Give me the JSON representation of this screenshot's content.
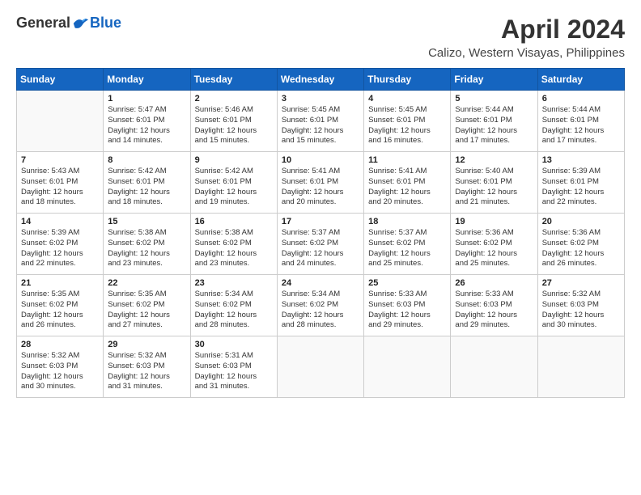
{
  "header": {
    "logo_general": "General",
    "logo_blue": "Blue",
    "month_title": "April 2024",
    "location": "Calizo, Western Visayas, Philippines"
  },
  "weekdays": [
    "Sunday",
    "Monday",
    "Tuesday",
    "Wednesday",
    "Thursday",
    "Friday",
    "Saturday"
  ],
  "weeks": [
    [
      {
        "day": "",
        "info": ""
      },
      {
        "day": "1",
        "info": "Sunrise: 5:47 AM\nSunset: 6:01 PM\nDaylight: 12 hours\nand 14 minutes."
      },
      {
        "day": "2",
        "info": "Sunrise: 5:46 AM\nSunset: 6:01 PM\nDaylight: 12 hours\nand 15 minutes."
      },
      {
        "day": "3",
        "info": "Sunrise: 5:45 AM\nSunset: 6:01 PM\nDaylight: 12 hours\nand 15 minutes."
      },
      {
        "day": "4",
        "info": "Sunrise: 5:45 AM\nSunset: 6:01 PM\nDaylight: 12 hours\nand 16 minutes."
      },
      {
        "day": "5",
        "info": "Sunrise: 5:44 AM\nSunset: 6:01 PM\nDaylight: 12 hours\nand 17 minutes."
      },
      {
        "day": "6",
        "info": "Sunrise: 5:44 AM\nSunset: 6:01 PM\nDaylight: 12 hours\nand 17 minutes."
      }
    ],
    [
      {
        "day": "7",
        "info": "Sunrise: 5:43 AM\nSunset: 6:01 PM\nDaylight: 12 hours\nand 18 minutes."
      },
      {
        "day": "8",
        "info": "Sunrise: 5:42 AM\nSunset: 6:01 PM\nDaylight: 12 hours\nand 18 minutes."
      },
      {
        "day": "9",
        "info": "Sunrise: 5:42 AM\nSunset: 6:01 PM\nDaylight: 12 hours\nand 19 minutes."
      },
      {
        "day": "10",
        "info": "Sunrise: 5:41 AM\nSunset: 6:01 PM\nDaylight: 12 hours\nand 20 minutes."
      },
      {
        "day": "11",
        "info": "Sunrise: 5:41 AM\nSunset: 6:01 PM\nDaylight: 12 hours\nand 20 minutes."
      },
      {
        "day": "12",
        "info": "Sunrise: 5:40 AM\nSunset: 6:01 PM\nDaylight: 12 hours\nand 21 minutes."
      },
      {
        "day": "13",
        "info": "Sunrise: 5:39 AM\nSunset: 6:01 PM\nDaylight: 12 hours\nand 22 minutes."
      }
    ],
    [
      {
        "day": "14",
        "info": "Sunrise: 5:39 AM\nSunset: 6:02 PM\nDaylight: 12 hours\nand 22 minutes."
      },
      {
        "day": "15",
        "info": "Sunrise: 5:38 AM\nSunset: 6:02 PM\nDaylight: 12 hours\nand 23 minutes."
      },
      {
        "day": "16",
        "info": "Sunrise: 5:38 AM\nSunset: 6:02 PM\nDaylight: 12 hours\nand 23 minutes."
      },
      {
        "day": "17",
        "info": "Sunrise: 5:37 AM\nSunset: 6:02 PM\nDaylight: 12 hours\nand 24 minutes."
      },
      {
        "day": "18",
        "info": "Sunrise: 5:37 AM\nSunset: 6:02 PM\nDaylight: 12 hours\nand 25 minutes."
      },
      {
        "day": "19",
        "info": "Sunrise: 5:36 AM\nSunset: 6:02 PM\nDaylight: 12 hours\nand 25 minutes."
      },
      {
        "day": "20",
        "info": "Sunrise: 5:36 AM\nSunset: 6:02 PM\nDaylight: 12 hours\nand 26 minutes."
      }
    ],
    [
      {
        "day": "21",
        "info": "Sunrise: 5:35 AM\nSunset: 6:02 PM\nDaylight: 12 hours\nand 26 minutes."
      },
      {
        "day": "22",
        "info": "Sunrise: 5:35 AM\nSunset: 6:02 PM\nDaylight: 12 hours\nand 27 minutes."
      },
      {
        "day": "23",
        "info": "Sunrise: 5:34 AM\nSunset: 6:02 PM\nDaylight: 12 hours\nand 28 minutes."
      },
      {
        "day": "24",
        "info": "Sunrise: 5:34 AM\nSunset: 6:02 PM\nDaylight: 12 hours\nand 28 minutes."
      },
      {
        "day": "25",
        "info": "Sunrise: 5:33 AM\nSunset: 6:03 PM\nDaylight: 12 hours\nand 29 minutes."
      },
      {
        "day": "26",
        "info": "Sunrise: 5:33 AM\nSunset: 6:03 PM\nDaylight: 12 hours\nand 29 minutes."
      },
      {
        "day": "27",
        "info": "Sunrise: 5:32 AM\nSunset: 6:03 PM\nDaylight: 12 hours\nand 30 minutes."
      }
    ],
    [
      {
        "day": "28",
        "info": "Sunrise: 5:32 AM\nSunset: 6:03 PM\nDaylight: 12 hours\nand 30 minutes."
      },
      {
        "day": "29",
        "info": "Sunrise: 5:32 AM\nSunset: 6:03 PM\nDaylight: 12 hours\nand 31 minutes."
      },
      {
        "day": "30",
        "info": "Sunrise: 5:31 AM\nSunset: 6:03 PM\nDaylight: 12 hours\nand 31 minutes."
      },
      {
        "day": "",
        "info": ""
      },
      {
        "day": "",
        "info": ""
      },
      {
        "day": "",
        "info": ""
      },
      {
        "day": "",
        "info": ""
      }
    ]
  ]
}
